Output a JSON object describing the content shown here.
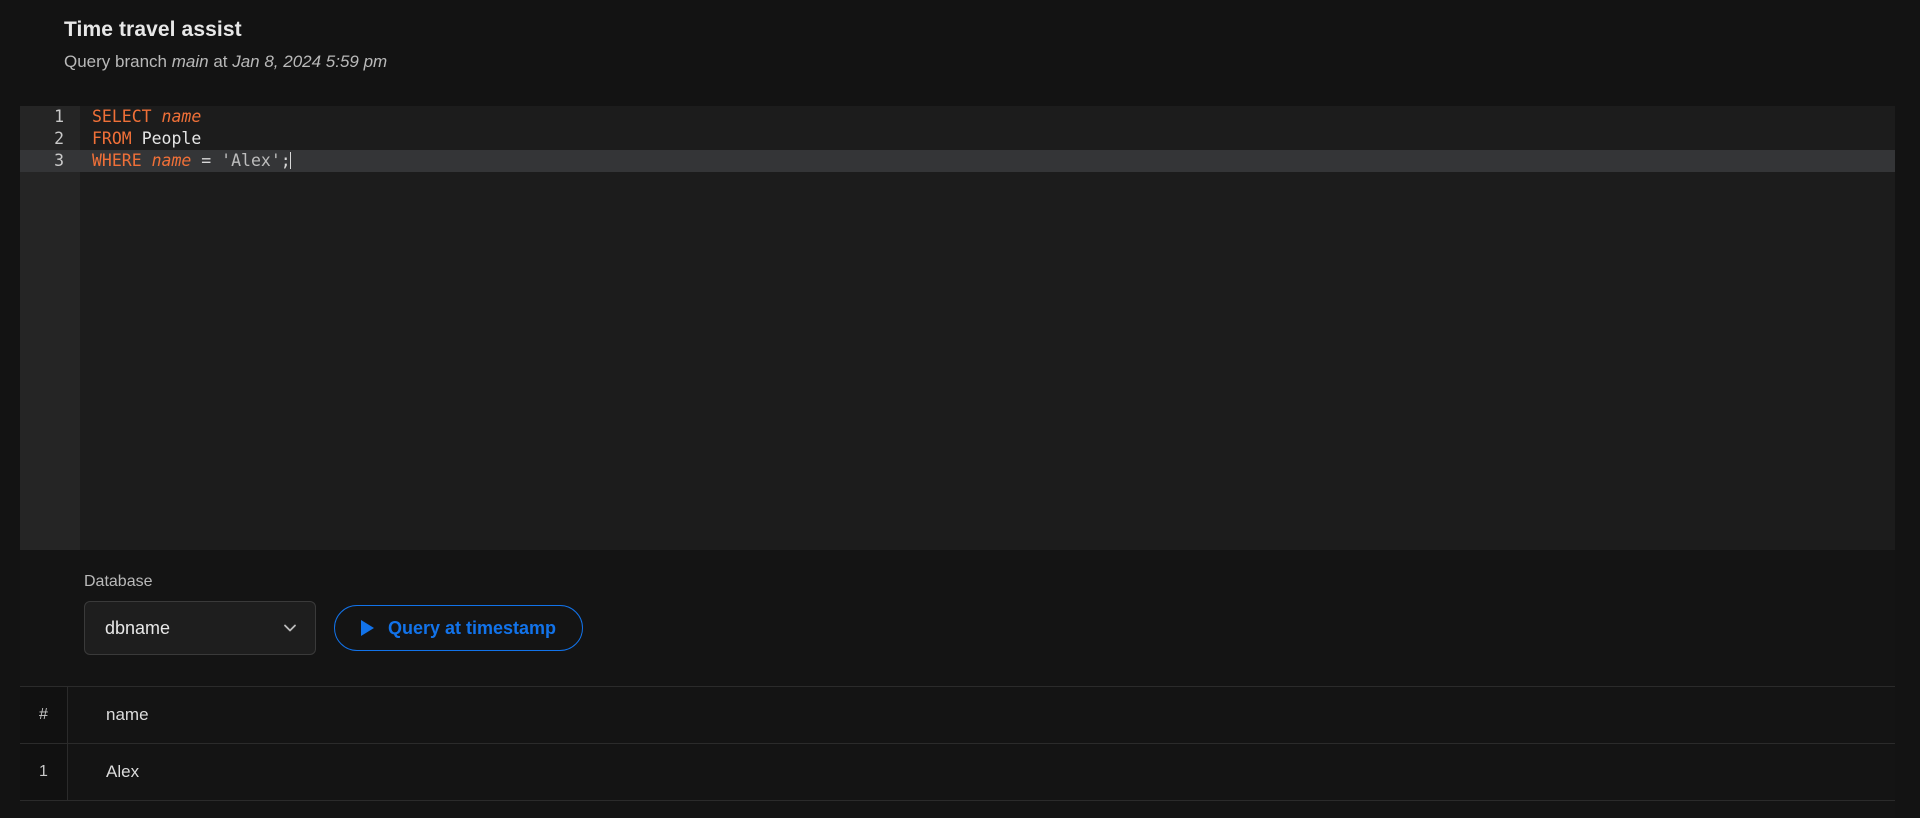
{
  "header": {
    "title": "Time travel assist",
    "subtitle_prefix": "Query branch ",
    "branch": "main",
    "subtitle_mid": " at ",
    "timestamp": "Jan 8, 2024 5:59 pm"
  },
  "editor": {
    "lines": [
      {
        "number": "1",
        "tokens": [
          {
            "t": "SELECT",
            "c": "kw"
          },
          {
            "t": " ",
            "c": "op"
          },
          {
            "t": "name",
            "c": "field"
          }
        ]
      },
      {
        "number": "2",
        "tokens": [
          {
            "t": "FROM",
            "c": "kw"
          },
          {
            "t": " ",
            "c": "op"
          },
          {
            "t": "People",
            "c": "ident"
          }
        ]
      },
      {
        "number": "3",
        "tokens": [
          {
            "t": "WHERE",
            "c": "kw"
          },
          {
            "t": " ",
            "c": "op"
          },
          {
            "t": "name",
            "c": "field"
          },
          {
            "t": " = ",
            "c": "op"
          },
          {
            "t": "'Alex'",
            "c": "str"
          },
          {
            "t": ";",
            "c": "op"
          }
        ]
      }
    ],
    "active_line": 3,
    "full_text": "SELECT name\nFROM People\nWHERE name = 'Alex';"
  },
  "controls": {
    "database_label": "Database",
    "database_value": "dbname",
    "chevron_icon": "chevron-down-icon",
    "run_icon": "play-icon",
    "run_label": "Query at timestamp"
  },
  "results": {
    "columns": [
      "#",
      "name"
    ],
    "rows": [
      {
        "index": "1",
        "name": "Alex"
      }
    ]
  },
  "colors": {
    "accent_blue": "#1273ea",
    "keyword_orange": "#f07038",
    "page_bg": "#131313",
    "editor_bg": "#1c1c1c",
    "active_line_bg": "#343537"
  }
}
